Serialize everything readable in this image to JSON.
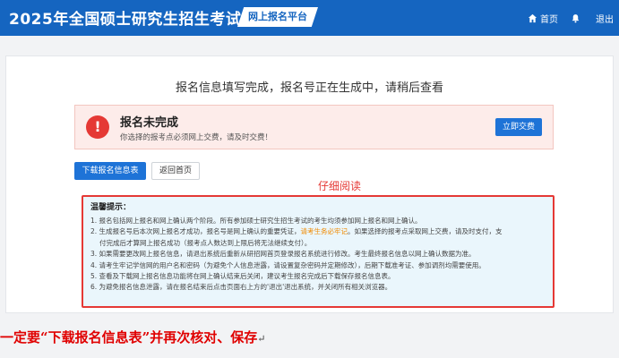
{
  "header": {
    "title": "2025年全国硕士研究生招生考试",
    "platform": "网上报名平台",
    "nav": [
      {
        "label": "首页",
        "icon": "home-icon"
      },
      {
        "label": "",
        "icon": "bell-icon"
      },
      {
        "label": "退出",
        "icon": ""
      }
    ]
  },
  "main": {
    "headline": "报名信息填写完成，报名号正在生成中，请稍后查看",
    "alert": {
      "title": "报名未完成",
      "text": "你选择的报考点必须网上交费，请及时交费！",
      "pay_label": "立即交费",
      "icon_glyph": "!"
    },
    "buttons": {
      "download": "下载报名信息表",
      "back": "返回首页"
    },
    "read_note": "仔细阅读",
    "tips": {
      "title": "温馨提示：",
      "line1": "1. 报名包括网上报名和网上确认两个阶段。所有参加硕士研究生招生考试的考生均须参加网上报名和网上确认。",
      "line2a": "2. 生成报名号后本次网上报名才成功，报名号是网上确认的重要凭证，",
      "line2b": "请考生务必牢记",
      "line2c": "。如果选择的报考点采取网上交费，请及时支付，支",
      "line2d": "付完成后才算网上报名成功（报考点人数达到上限后将无法继续支付）。",
      "line3": "3. 如果需要更改网上报名信息，请退出系统后重新从研招网首页登录报名系统进行修改。考生最终报名信息以网上确认数据为准。",
      "line4": "4. 请考生牢记学信网的用户名和密码（为避免个人信息泄露，请设置复杂密码并定期修改），后期下载准考证、参加调剂均需要使用。",
      "line5": "5. 查看及下载网上报名信息功能将在网上确认结束后关闭，建议考生报名完成后下载保存报名信息表。",
      "line6": "6. 为避免报名信息泄露，请在报名结束后点击页面右上方的'退出'退出系统，并关闭所有相关浏览器。"
    }
  },
  "caption": {
    "text": "一定要“下载报名信息表”并再次核对、保存",
    "mark": "↵"
  },
  "colors": {
    "header_bg": "#1565c0",
    "primary": "#1e73d7",
    "alert_red": "#e53935",
    "alert_bg": "#fdecea",
    "tips_bg": "#eaf6fc",
    "highlight_orange": "#f08a00",
    "caption_red": "#e00000"
  }
}
